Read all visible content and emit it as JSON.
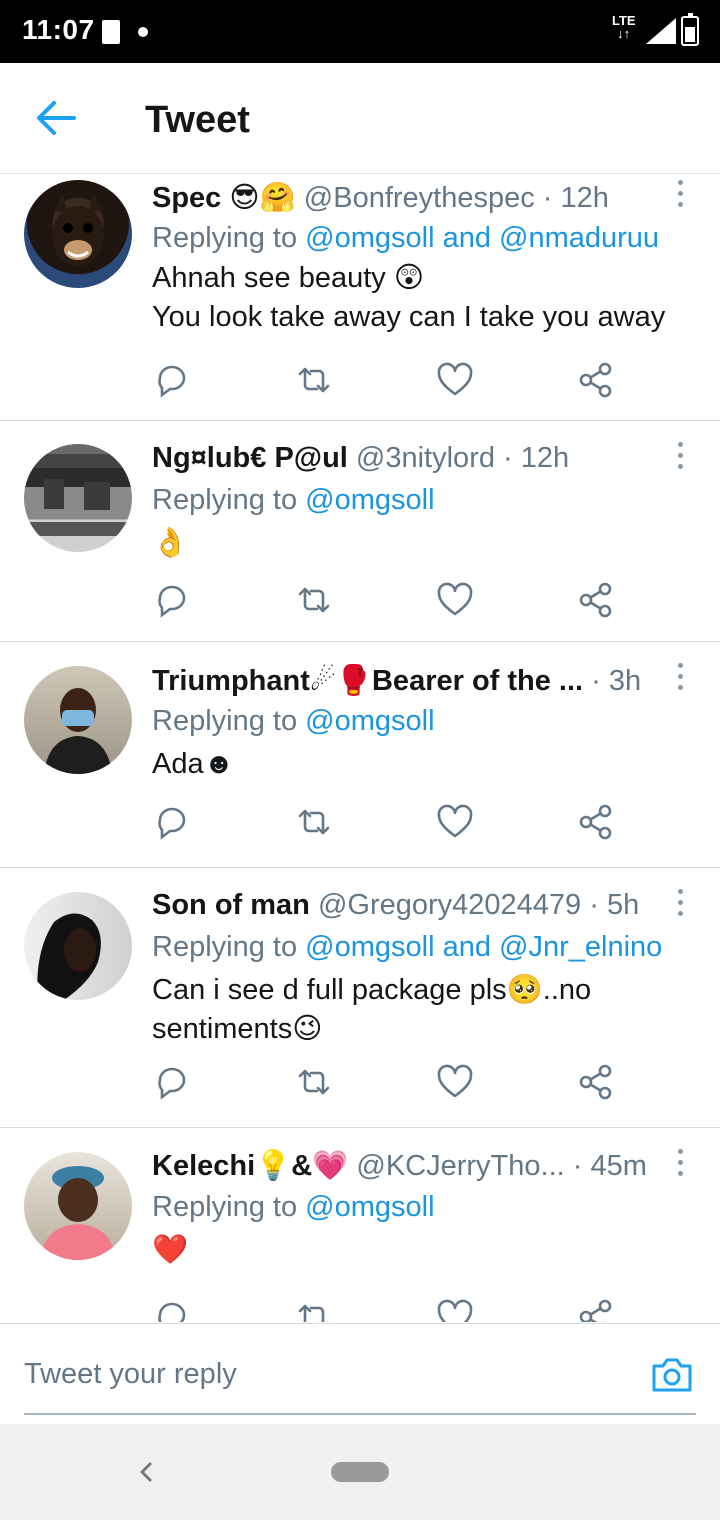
{
  "status_bar": {
    "time": "11:07",
    "network": "LTE"
  },
  "header": {
    "title": "Tweet"
  },
  "tweets": [
    {
      "name": "Spec 😎🤗",
      "handle": "@Bonfreythespec · 12h",
      "replying_prefix": "Replying to ",
      "replying_to": "@omgsoll and @nmaduruu",
      "text_lines": [
        "Ahnah see beauty 😲",
        "You look take away can I take you away"
      ]
    },
    {
      "name": "Ng¤lub€ P@ul",
      "handle": "@3nitylord · 12h",
      "replying_prefix": "Replying to ",
      "replying_to": "@omgsoll",
      "text_lines": [
        "👌"
      ]
    },
    {
      "name": "Triumphant☄🥊Bearer of the ...",
      "handle": "· 3h",
      "replying_prefix": "Replying to ",
      "replying_to": "@omgsoll",
      "text_lines": [
        "Ada☻"
      ]
    },
    {
      "name": "Son of man",
      "handle": "@Gregory42024479 · 5h",
      "replying_prefix": "Replying to ",
      "replying_to": "@omgsoll and @Jnr_elnino",
      "text_lines": [
        "Can i see d full package pls🥺..no",
        "sentiments😉"
      ]
    },
    {
      "name": "Kelechi💡&💗",
      "handle": "@KCJerryTho... · 45m",
      "replying_prefix": "Replying to ",
      "replying_to": "@omgsoll",
      "text_lines": [
        "❤️"
      ]
    }
  ],
  "icons": {
    "reply": "reply-icon",
    "retweet": "retweet-icon",
    "like": "like-icon",
    "share": "share-icon",
    "more": "more-icon"
  },
  "composer": {
    "placeholder": "Tweet your reply"
  },
  "colors": {
    "accent": "#1b95e0",
    "text": "#14171a",
    "muted": "#657786"
  }
}
